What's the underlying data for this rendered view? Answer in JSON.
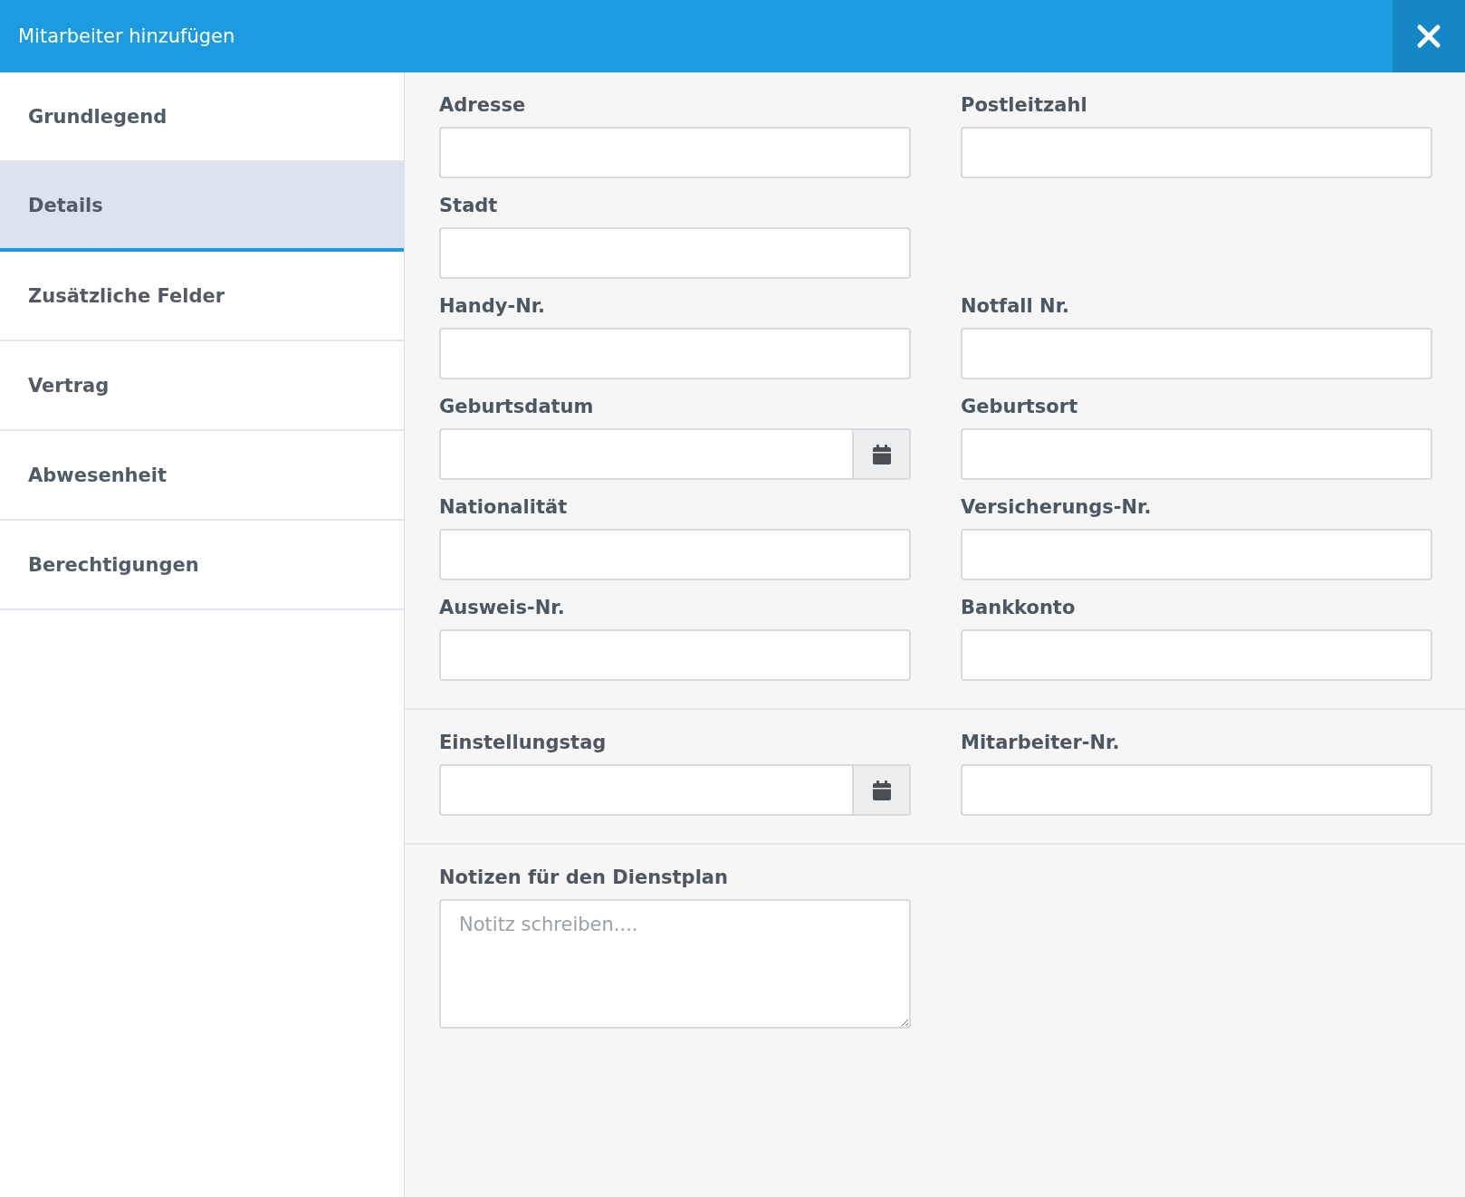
{
  "window": {
    "title": "Mitarbeiter hinzufügen"
  },
  "sidebar": {
    "items": [
      {
        "label": "Grundlegend",
        "selected": false
      },
      {
        "label": "Details",
        "selected": true
      },
      {
        "label": "Zusätzliche Felder",
        "selected": false
      },
      {
        "label": "Vertrag",
        "selected": false
      },
      {
        "label": "Abwesenheit",
        "selected": false
      },
      {
        "label": "Berechtigungen",
        "selected": false
      }
    ]
  },
  "sections": [
    {
      "rows": [
        [
          {
            "label": "Adresse",
            "kind": "text"
          },
          {
            "label": "Postleitzahl",
            "kind": "text"
          }
        ],
        [
          {
            "label": "Stadt",
            "kind": "text"
          }
        ],
        [
          {
            "label": "Handy-Nr.",
            "kind": "text"
          },
          {
            "label": "Notfall Nr.",
            "kind": "text"
          }
        ],
        [
          {
            "label": "Geburtsdatum",
            "kind": "date"
          },
          {
            "label": "Geburtsort",
            "kind": "text"
          }
        ],
        [
          {
            "label": "Nationalität",
            "kind": "text"
          },
          {
            "label": "Versicherungs-Nr.",
            "kind": "text"
          }
        ],
        [
          {
            "label": "Ausweis-Nr.",
            "kind": "text"
          },
          {
            "label": "Bankkonto",
            "kind": "text"
          }
        ]
      ]
    },
    {
      "rows": [
        [
          {
            "label": "Einstellungstag",
            "kind": "date"
          },
          {
            "label": "Mitarbeiter-Nr.",
            "kind": "text"
          }
        ]
      ]
    },
    {
      "rows": [
        [
          {
            "label": "Notizen für den Dienstplan",
            "kind": "textarea",
            "placeholder": "Notitz schreiben...."
          }
        ]
      ]
    }
  ]
}
